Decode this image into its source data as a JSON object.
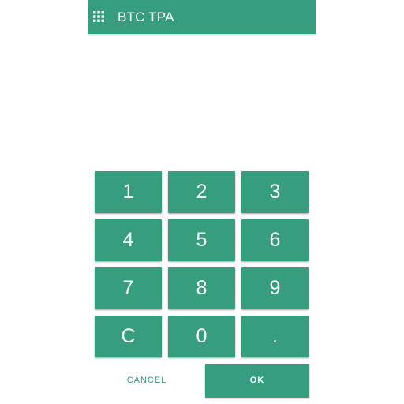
{
  "app": {
    "title": "BTC TPA",
    "menu_icon": "grid-menu-icon",
    "accent_color": "#369e7e"
  },
  "keypad": {
    "keys": [
      "1",
      "2",
      "3",
      "4",
      "5",
      "6",
      "7",
      "8",
      "9",
      "C",
      "0",
      "."
    ]
  },
  "actions": {
    "cancel_label": "CANCEL",
    "ok_label": "OK"
  }
}
